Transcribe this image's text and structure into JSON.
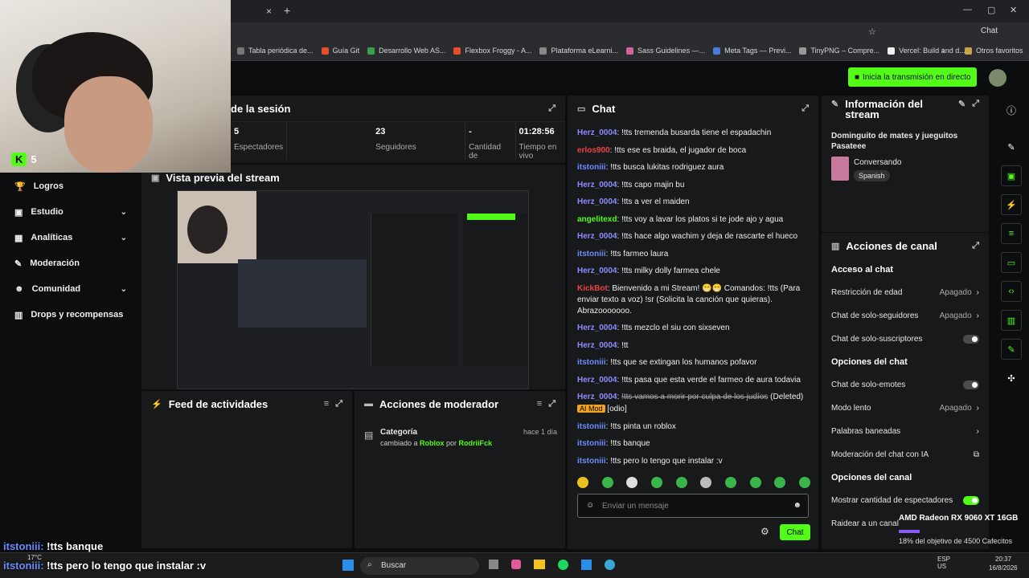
{
  "browser": {
    "tab_add": "+",
    "tab_close": "×",
    "window_buttons": [
      "—",
      "▢",
      "✕"
    ],
    "chat_label": "Chat",
    "bookmarks": [
      "Tabla periódica de...",
      "Guía Git",
      "Desarrollo Web AS...",
      "Flexbox Froggy - A...",
      "Plataforma eLearni...",
      "Sass Guidelines —...",
      "Meta Tags — Previ...",
      "TinyPNG – Compre...",
      "Vercel: Build and d..."
    ],
    "bookmark_more": "›",
    "other_bookmarks": "Otros favoritos"
  },
  "topbar": {
    "go_live": "Inicia la transmisión en directo"
  },
  "overlay": {
    "kick_count": "5",
    "msg1_user": "itstoniii:",
    "msg1_text": " !tts banque",
    "msg2_user": "itstoniii:",
    "msg2_text": " !tts pero lo tengo que instalar :v",
    "gpu": "AMD Radeon RX 9060 XT 16GB",
    "goal": "18% del objetivo de 4500 Cafecitos"
  },
  "sidebar": {
    "items": [
      {
        "label": "Logros",
        "icon": "🏆"
      },
      {
        "label": "Estudio",
        "icon": "▣",
        "chev": "⌄"
      },
      {
        "label": "Analíticas",
        "icon": "▦",
        "chev": "⌄"
      },
      {
        "label": "Moderación",
        "icon": "✎"
      },
      {
        "label": "Comunidad",
        "icon": "☻",
        "chev": "⌄"
      },
      {
        "label": "Drops y recompensas",
        "icon": "▥"
      }
    ]
  },
  "session": {
    "title": "de la sesión",
    "stats": [
      {
        "value": "5",
        "label": "Espectadores"
      },
      {
        "value": "23",
        "label": "Seguidores"
      },
      {
        "value": "-",
        "label": "Cantidad de"
      },
      {
        "value": "01:28:56",
        "label": "Tiempo en vivo"
      }
    ]
  },
  "preview": {
    "title": "Vista previa del stream"
  },
  "feed": {
    "title": "Feed de actividades"
  },
  "moderator": {
    "title": "Acciones de moderador",
    "event_title": "Categoría",
    "event_time": "hace 1 día",
    "event_prefix": "cambiado a ",
    "event_category": "Roblox",
    "event_by": " por ",
    "event_user": "RodriiFck"
  },
  "chat": {
    "title": "Chat",
    "placeholder": "Enviar un mensaje",
    "send": "Chat",
    "messages": [
      {
        "user": "Herz_0004",
        "color": "#8c8cff",
        "text": ": !tts tremenda busarda tiene el espadachin"
      },
      {
        "user": "erlos900",
        "color": "#e84545",
        "text": ": !tts ese es braida, el jugador de boca"
      },
      {
        "user": "itstoniii",
        "color": "#6b8cff",
        "text": ": !tts busca lukitas rodriguez aura"
      },
      {
        "user": "Herz_0004",
        "color": "#8c8cff",
        "text": ": !tts capo majin bu"
      },
      {
        "user": "Herz_0004",
        "color": "#8c8cff",
        "text": ": !tts a ver el maiden"
      },
      {
        "user": "angelitexd",
        "color": "#53fc18",
        "text": ": !tts voy a lavar los platos si te jode ajo y agua"
      },
      {
        "user": "Herz_0004",
        "color": "#8c8cff",
        "text": ": !tts hace algo wachim y deja de rascarte el hueco"
      },
      {
        "user": "itstoniii",
        "color": "#6b8cff",
        "text": ": !tts farmeo laura"
      },
      {
        "user": "Herz_0004",
        "color": "#8c8cff",
        "text": ": !tts milky dolly farmea chele"
      },
      {
        "user": "KickBot",
        "color": "#e84545",
        "text": ": Bienvenido a mi Stream! 😁😁 Comandos: !tts (Para enviar texto a voz) !sr (Solicita la canción que quieras). Abrazooooooo."
      },
      {
        "user": "Herz_0004",
        "color": "#8c8cff",
        "text": ": !tts mezclo el siu con sixseven"
      },
      {
        "user": "Herz_0004",
        "color": "#8c8cff",
        "text": ": !tt"
      },
      {
        "user": "itstoniii",
        "color": "#6b8cff",
        "text": ": !tts que se extingan los humanos pofavor"
      },
      {
        "user": "Herz_0004",
        "color": "#8c8cff",
        "text": ": !tts pasa que esta verde el farmeo de aura todavia"
      },
      {
        "user": "Herz_0004",
        "color": "#8c8cff",
        "text": ": ",
        "deleted": "!tts vamos a morir por culpa de los judíos",
        "deleted_note": " (Deleted) ",
        "tag": "AI Mod",
        "tag_extra": " [odio]"
      },
      {
        "user": "itstoniii",
        "color": "#6b8cff",
        "text": ": !tts pinta un roblox"
      },
      {
        "user": "itstoniii",
        "color": "#6b8cff",
        "text": ": !tts banque"
      },
      {
        "user": "itstoniii",
        "color": "#6b8cff",
        "text": ": !tts pero lo tengo que instalar :v"
      }
    ]
  },
  "streaminfo": {
    "title": "Información del stream",
    "stream_title": "Dominguito de mates y jueguitos Pasateee",
    "category": "Conversando",
    "language": "Spanish"
  },
  "channel": {
    "title": "Acciones de canal",
    "chat_section": "Acceso al chat",
    "chat_rows": [
      {
        "label": "Restricción de edad",
        "value": "Apagado"
      },
      {
        "label": "Chat de solo-seguidores",
        "value": "Apagado"
      },
      {
        "label": "Chat de solo-suscriptores",
        "toggle": "off"
      }
    ],
    "options_section": "Opciones del chat",
    "options_rows": [
      {
        "label": "Chat de solo-emotes",
        "toggle": "off"
      },
      {
        "label": "Modo lento",
        "value": "Apagado"
      },
      {
        "label": "Palabras baneadas"
      },
      {
        "label": "Moderación del chat con IA"
      }
    ],
    "canal_section": "Opciones del canal",
    "canal_rows": [
      {
        "label": "Mostrar cantidad de espectadores",
        "toggle": "on"
      },
      {
        "label": "Raidear a un canal"
      }
    ]
  },
  "taskbar": {
    "search": "Buscar",
    "weather": "17°C",
    "lang": "ESP\nUS",
    "time": "20:37",
    "date": "16/8/2026"
  }
}
